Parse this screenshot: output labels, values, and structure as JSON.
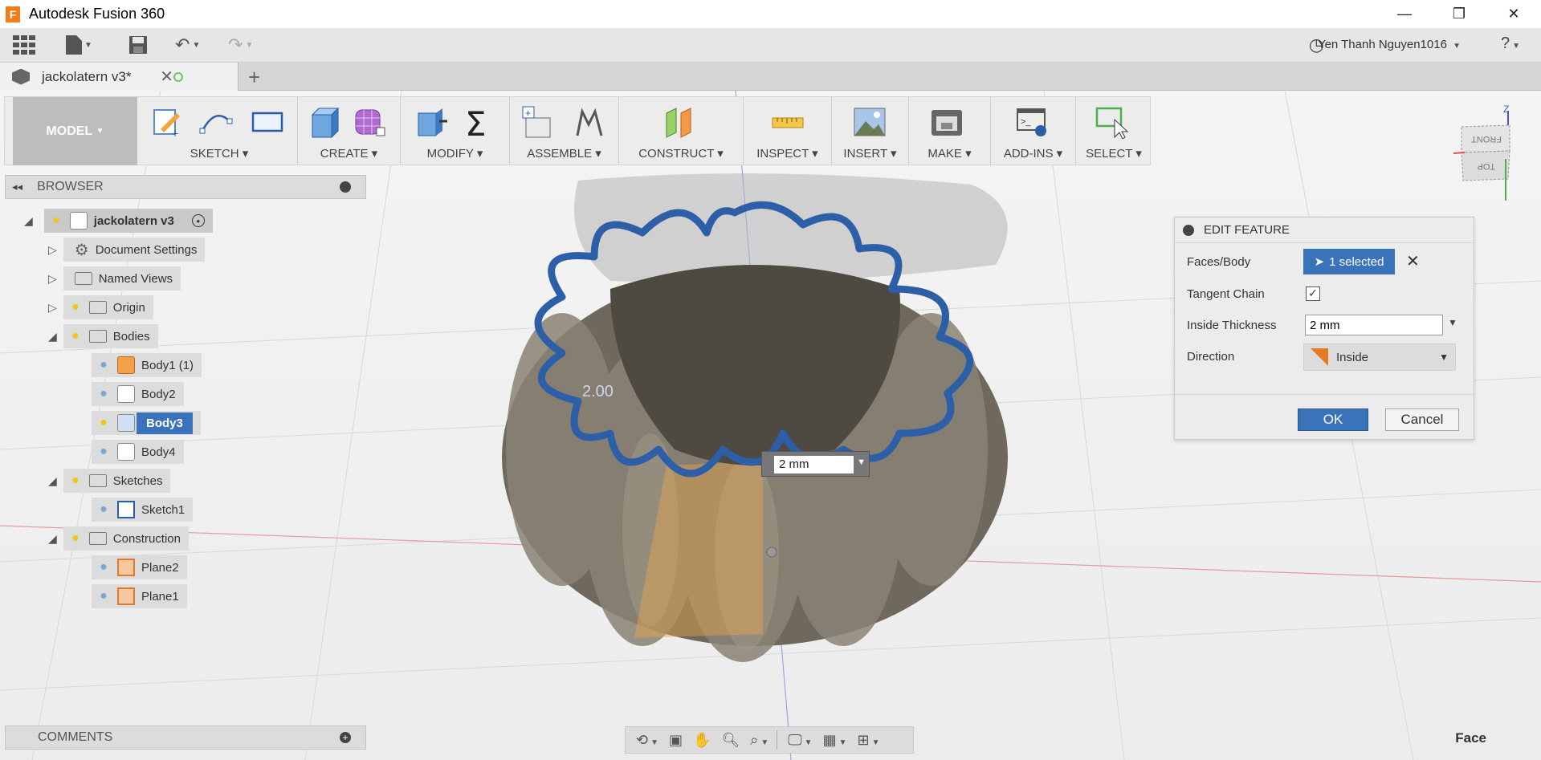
{
  "window": {
    "title": "Autodesk Fusion 360",
    "app_icon": "F"
  },
  "quick_access": {
    "user": "Yen Thanh Nguyen1016"
  },
  "tab": {
    "name": "jackolatern v3*"
  },
  "ribbon": {
    "mode": "MODEL",
    "groups": [
      "SKETCH",
      "CREATE",
      "MODIFY",
      "ASSEMBLE",
      "CONSTRUCT",
      "INSPECT",
      "INSERT",
      "MAKE",
      "ADD-INS",
      "SELECT"
    ]
  },
  "browser": {
    "title": "BROWSER",
    "root": "jackolatern v3",
    "items": {
      "doc_settings": "Document Settings",
      "named_views": "Named Views",
      "origin": "Origin",
      "bodies": "Bodies",
      "body1": "Body1 (1)",
      "body2": "Body2",
      "body3": "Body3",
      "body4": "Body4",
      "sketches": "Sketches",
      "sketch1": "Sketch1",
      "construction": "Construction",
      "plane2": "Plane2",
      "plane1": "Plane1"
    }
  },
  "comments": {
    "title": "COMMENTS"
  },
  "dialog": {
    "title": "EDIT FEATURE",
    "faces_label": "Faces/Body",
    "faces_value": "1 selected",
    "tangent_label": "Tangent Chain",
    "tangent_checked": true,
    "thickness_label": "Inside Thickness",
    "thickness_value": "2 mm",
    "direction_label": "Direction",
    "direction_value": "Inside",
    "ok": "OK",
    "cancel": "Cancel"
  },
  "canvas": {
    "input_value": "2 mm",
    "dim_label": "2.00"
  },
  "viewcube": {
    "front": "FRONT",
    "top": "TOP",
    "axis_z": "Z"
  },
  "status": {
    "selection": "Face"
  },
  "colors": {
    "accent": "#3a73b9",
    "selection_outline": "#2d5fa8",
    "model": "#6e6658"
  }
}
